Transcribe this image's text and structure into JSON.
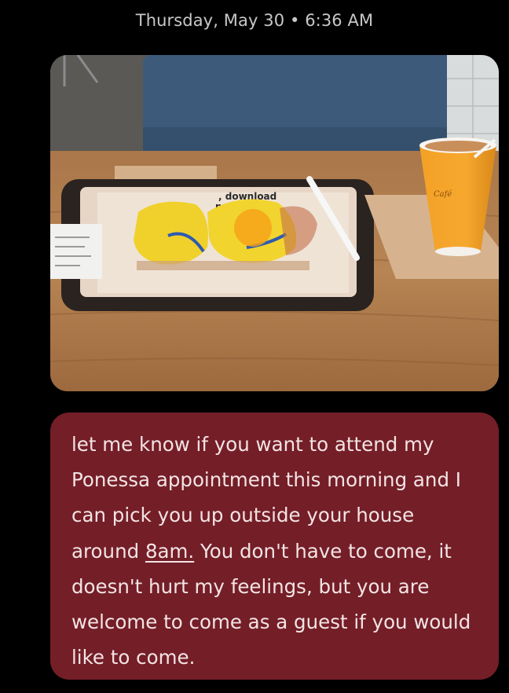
{
  "timestamp": "Thursday, May 30 • 6:36 AM",
  "photo": {
    "tray_sign": ", download\npp!",
    "cup_brand": "Café"
  },
  "message": {
    "text_before": "let me know if you want to attend my Ponessa appointment this morning and I can pick you up outside your house around ",
    "time_link": "8am.",
    "text_after": " You don't have to come, it doesn't hurt my feelings, but you are welcome to come as a guest if you would like to come."
  },
  "colors": {
    "bubble": "#741e28",
    "background": "#000000"
  }
}
